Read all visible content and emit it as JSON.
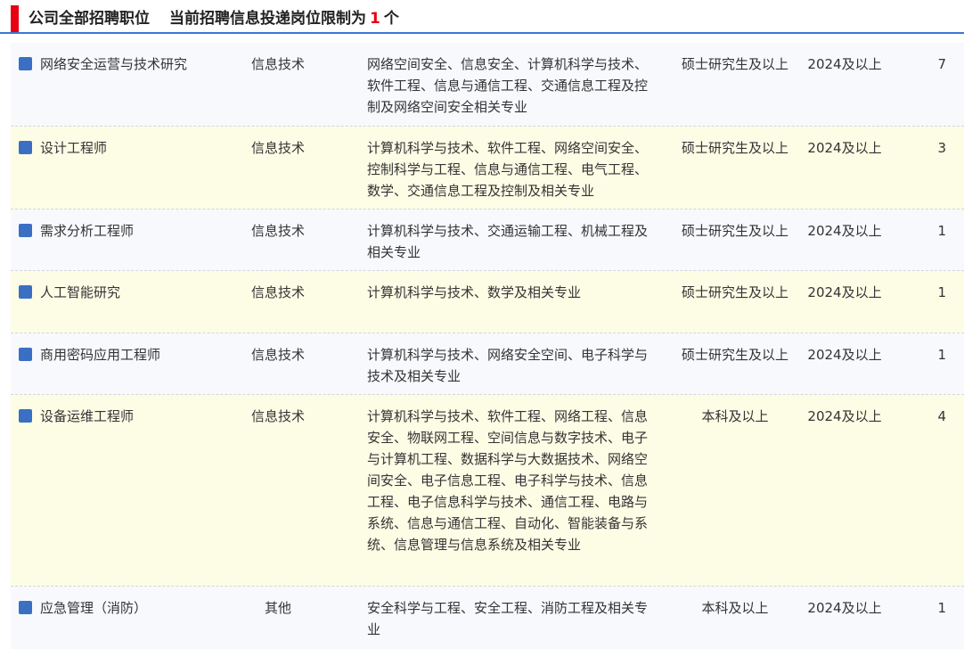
{
  "header": {
    "title": "公司全部招聘职位",
    "limit_prefix": "当前招聘信息投递岗位限制为",
    "limit_count": "1",
    "limit_suffix": "个"
  },
  "jobs": [
    {
      "name": "网络安全运营与技术研究",
      "category": "信息技术",
      "major": "网络空间安全、信息安全、计算机科学与技术、软件工程、信息与通信工程、交通信息工程及控制及网络空间安全相关专业",
      "education": "硕士研究生及以上",
      "year": "2024及以上",
      "count": "7"
    },
    {
      "name": "设计工程师",
      "category": "信息技术",
      "major": "计算机科学与技术、软件工程、网络空间安全、控制科学与工程、信息与通信工程、电气工程、数学、交通信息工程及控制及相关专业",
      "education": "硕士研究生及以上",
      "year": "2024及以上",
      "count": "3"
    },
    {
      "name": "需求分析工程师",
      "category": "信息技术",
      "major": "计算机科学与技术、交通运输工程、机械工程及相关专业",
      "education": "硕士研究生及以上",
      "year": "2024及以上",
      "count": "1"
    },
    {
      "name": "人工智能研究",
      "category": "信息技术",
      "major": "计算机科学与技术、数学及相关专业",
      "education": "硕士研究生及以上",
      "year": "2024及以上",
      "count": "1"
    },
    {
      "name": "商用密码应用工程师",
      "category": "信息技术",
      "major": "计算机科学与技术、网络安全空间、电子科学与技术及相关专业",
      "education": "硕士研究生及以上",
      "year": "2024及以上",
      "count": "1"
    },
    {
      "name": "设备运维工程师",
      "category": "信息技术",
      "major": "计算机科学与技术、软件工程、网络工程、信息安全、物联网工程、空间信息与数字技术、电子与计算机工程、数据科学与大数据技术、网络空间安全、电子信息工程、电子科学与技术、信息工程、电子信息科学与技术、通信工程、电路与系统、信息与通信工程、自动化、智能装备与系统、信息管理与信息系统及相关专业",
      "education": "本科及以上",
      "year": "2024及以上",
      "count": "4"
    },
    {
      "name": "应急管理（消防）",
      "category": "其他",
      "major": "安全科学与工程、安全工程、消防工程及相关专业",
      "education": "本科及以上",
      "year": "2024及以上",
      "count": "1"
    }
  ]
}
